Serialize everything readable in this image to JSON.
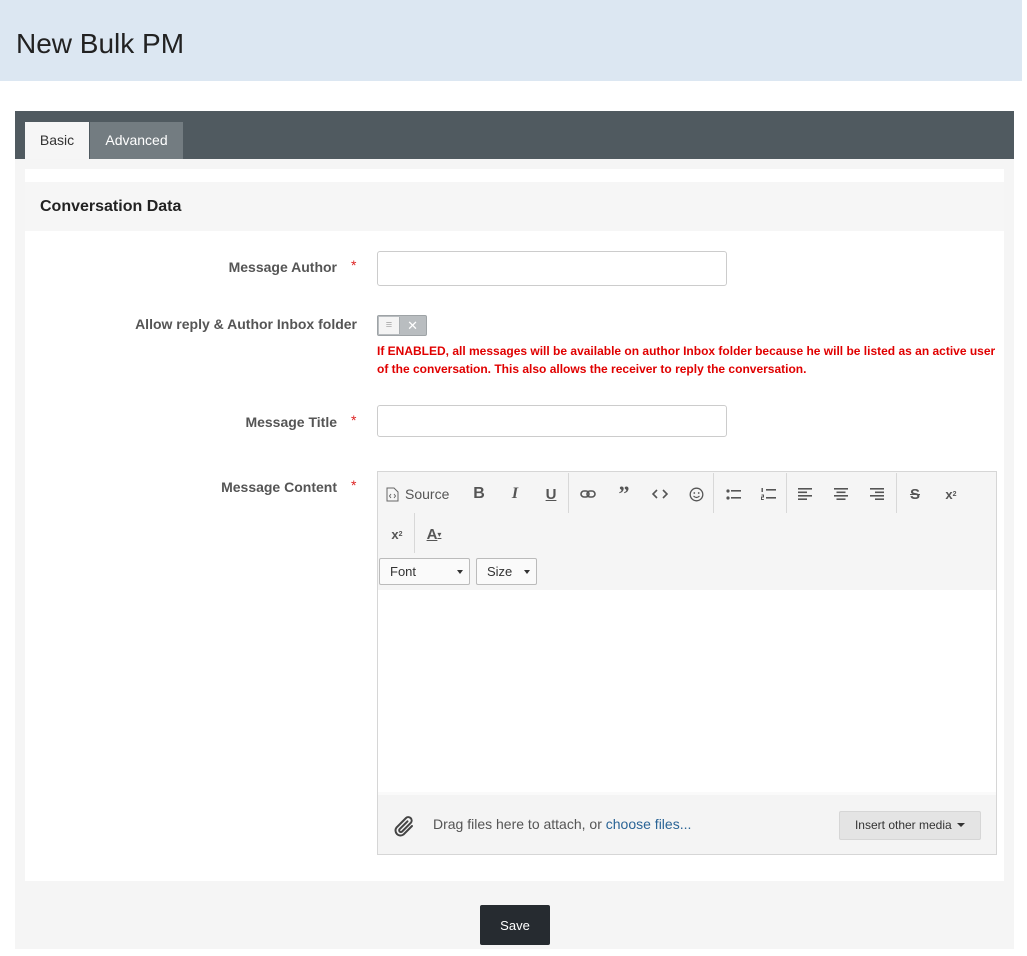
{
  "page": {
    "title": "New Bulk PM"
  },
  "tabs": [
    {
      "label": "Basic",
      "active": true
    },
    {
      "label": "Advanced",
      "active": false
    }
  ],
  "section": {
    "title": "Conversation Data"
  },
  "form": {
    "required_marker": "*",
    "author": {
      "label": "Message Author",
      "value": ""
    },
    "allow_reply": {
      "label": "Allow reply & Author Inbox folder",
      "enabled": false,
      "hint": "If ENABLED, all messages will be available on author Inbox folder because he will be listed as an active user of the conversation. This also allows the receiver to reply the conversation."
    },
    "title": {
      "label": "Message Title",
      "value": ""
    },
    "content": {
      "label": "Message Content",
      "toolbar": {
        "source_label": "Source",
        "buttons": [
          "bold-icon",
          "italic-icon",
          "underline-icon",
          "link-icon",
          "quote-icon",
          "code-icon",
          "smiley-icon",
          "bullet-list-icon",
          "numbered-list-icon",
          "align-left-icon",
          "align-center-icon",
          "align-right-icon",
          "strikethrough-icon",
          "superscript-icon",
          "subscript-icon",
          "text-color-icon"
        ],
        "font_label": "Font",
        "size_label": "Size"
      },
      "body": "",
      "attach": {
        "text": "Drag files here to attach, or ",
        "link": "choose files...",
        "insert_media": "Insert other media"
      }
    }
  },
  "actions": {
    "save": "Save"
  },
  "colors": {
    "header_bg": "#dce7f2",
    "tabbar_bg": "#505a60",
    "required": "#dd2222",
    "hint": "#e00000",
    "save_bg": "#262b30",
    "link": "#2a6496"
  }
}
